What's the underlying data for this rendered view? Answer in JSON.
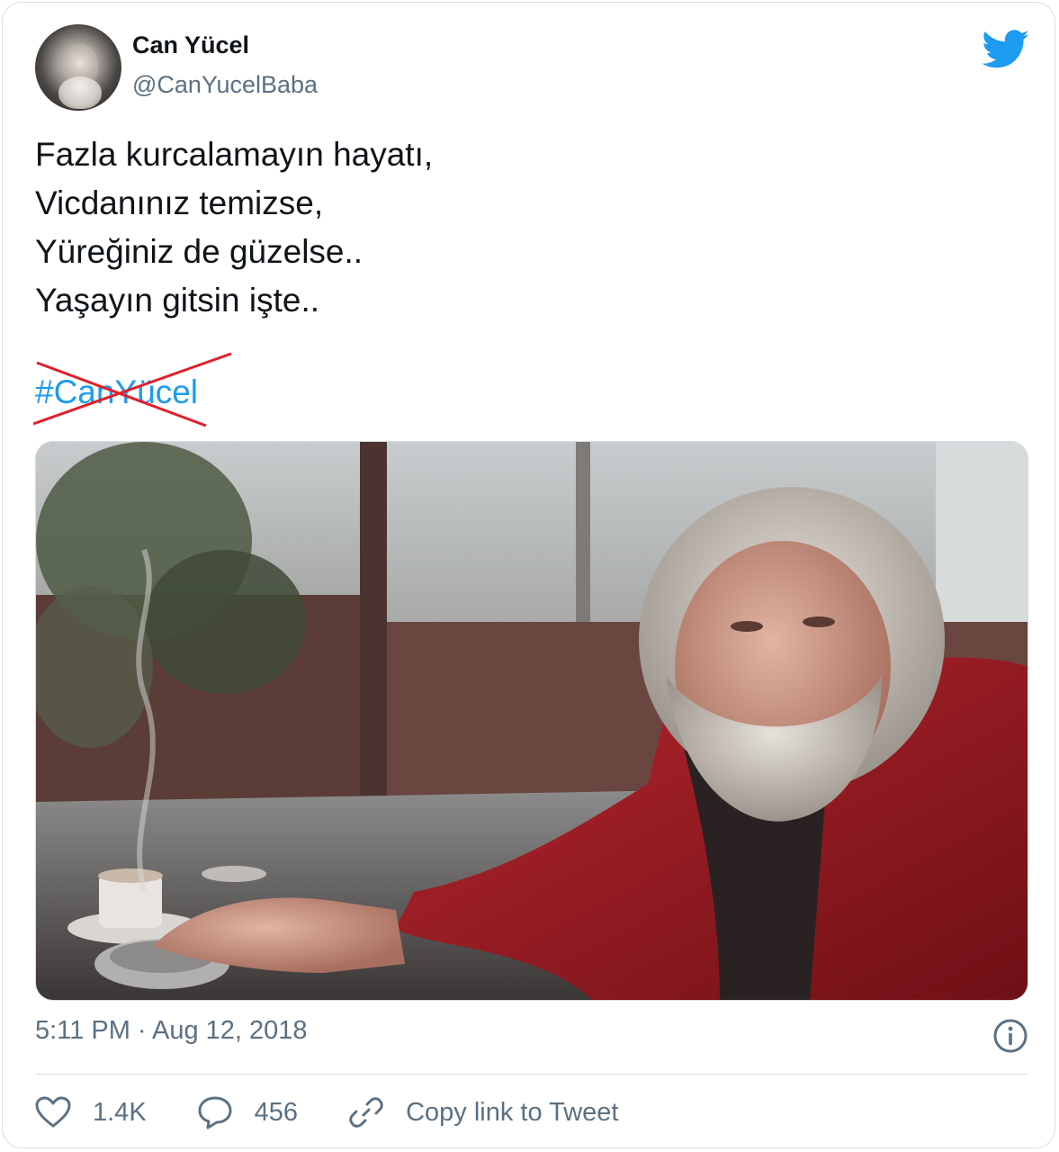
{
  "author": {
    "name": "Can Yücel",
    "handle": "@CanYucelBaba"
  },
  "tweet": {
    "lines": [
      "Fazla kurcalamayın hayatı,",
      "Vicdanınız temizse,",
      "Yüreğiniz de güzelse..",
      "Yaşayın gitsin işte.."
    ],
    "hashtag": "#CanYücel"
  },
  "meta": {
    "timestamp": "5:11 PM · Aug 12, 2018"
  },
  "actions": {
    "likes": "1.4K",
    "replies": "456",
    "copy_link": "Copy link to Tweet"
  },
  "colors": {
    "accent": "#1d9bf0",
    "muted": "#5b7083",
    "strike": "#e0202a"
  },
  "icons": [
    "twitter-bird-icon",
    "info-icon",
    "heart-icon",
    "reply-icon",
    "link-icon"
  ]
}
